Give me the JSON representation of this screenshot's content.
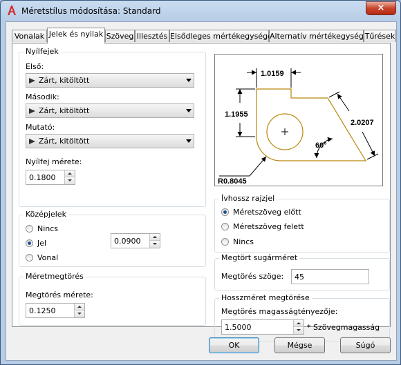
{
  "window": {
    "title": "Méretstílus módosítása: Standard",
    "close_glyph": "×"
  },
  "tabs": [
    {
      "label": "Vonalak"
    },
    {
      "label": "Jelek és nyilak"
    },
    {
      "label": "Szöveg"
    },
    {
      "label": "Illesztés"
    },
    {
      "label": "Elsődleges mértékegységek"
    },
    {
      "label": "Alternatív mértékegységek"
    },
    {
      "label": "Tűrések"
    }
  ],
  "arrowheads": {
    "group_title": "Nyílfejek",
    "first": {
      "label": "Első:",
      "value": "Zárt, kitöltött"
    },
    "second": {
      "label": "Második:",
      "value": "Zárt, kitöltött"
    },
    "leader": {
      "label": "Mutató:",
      "value": "Zárt, kitöltött"
    },
    "size": {
      "label": "Nyílfej mérete:",
      "value": "0.1800"
    }
  },
  "center_marks": {
    "group_title": "Középjelek",
    "options": [
      "Nincs",
      "Jel",
      "Vonal"
    ],
    "selected": "Jel",
    "size_value": "0.0900"
  },
  "dim_break": {
    "group_title": "Méretmegtörés",
    "label": "Megtörés mérete:",
    "value": "0.1250"
  },
  "preview": {
    "dim_top": "1.0159",
    "dim_left": "1.1955",
    "dim_right": "2.0207",
    "angle": "60°",
    "radius": "R0.8045"
  },
  "arc_length": {
    "group_title": "Ívhossz rajzjel",
    "options": [
      "Méretszöveg előtt",
      "Méretszöveg felett",
      "Nincs"
    ],
    "selected": "Méretszöveg előtt"
  },
  "jog_radius": {
    "group_title": "Megtört sugárméret",
    "label": "Megtörés szöge:",
    "value": "45"
  },
  "linear_jog": {
    "group_title": "Hosszméret megtörése",
    "label": "Megtörés magasságtényezője:",
    "value": "1.5000",
    "suffix": "* Szövegmagasság"
  },
  "buttons": {
    "ok": "OK",
    "cancel": "Mégse",
    "help": "Súgó"
  },
  "colors": {
    "shape_stroke": "#b8860b",
    "title_icon": "#d22b2b"
  }
}
